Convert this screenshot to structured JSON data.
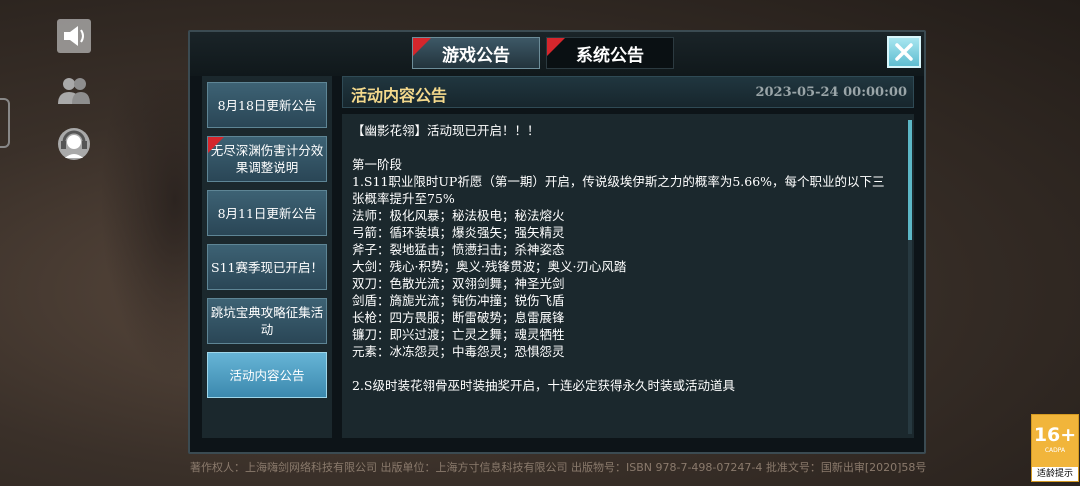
{
  "tabs": [
    {
      "label": "游戏公告",
      "active": true
    },
    {
      "label": "系统公告",
      "active": false
    }
  ],
  "sidebar": {
    "items": [
      {
        "label": "8月18日更新公告"
      },
      {
        "label": "无尽深渊伤害计分效果调整说明"
      },
      {
        "label": "8月11日更新公告"
      },
      {
        "label": "S11赛季现已开启！"
      },
      {
        "label": "跳坑宝典攻略征集活动"
      },
      {
        "label": "活动内容公告"
      }
    ],
    "selected": "活动内容公告"
  },
  "content": {
    "title": "活动内容公告",
    "date": "2023-05-24  00:00:00",
    "body": "【幽影花翎】活动现已开启！！！\n\n第一阶段\n1.S11职业限时UP祈愿（第一期）开启，传说级埃伊斯之力的概率为5.66%，每个职业的以下三张概率提升至75%\n法师：极化风暴；秘法极电；秘法熔火\n弓箭：循环装填；爆炎强矢；强矢精灵\n斧子：裂地猛击；愤懑扫击；杀神姿态\n大剑：残心·积势；奥义·残锋贯波；奥义·刃心风踏\n双刀：色散光流；双翎剑舞；神圣光剑\n剑盾：旖旎光流；钝伤冲撞；锐伤飞盾\n长枪：四方畏服；断雷破势；息雷展锋\n镰刀：即兴过渡；亡灵之舞；魂灵牺牲\n元素：冰冻怨灵；中毒怨灵；恐惧怨灵\n\n2.S级时装花翎骨巫时装抽奖开启，十连必定获得永久时装或活动道具"
  },
  "footer": {
    "line": "著作权人：上海嗨剑网络科技有限公司  出版单位：上海方寸信息科技有限公司  出版物号：ISBN 978-7-498-07247-4  批准文号：国新出审[2020]58号"
  },
  "age_badge": {
    "rating": "16+",
    "org": "CADPA",
    "tip": "适龄提示"
  },
  "icons": [
    "speaker-icon",
    "friends-icon",
    "support-headset-icon",
    "close-icon"
  ],
  "colors": {
    "accent": "#5fbdd0",
    "title_gold": "#f4d98c",
    "flag_red": "#d5262c",
    "badge": "#f1b53b"
  }
}
